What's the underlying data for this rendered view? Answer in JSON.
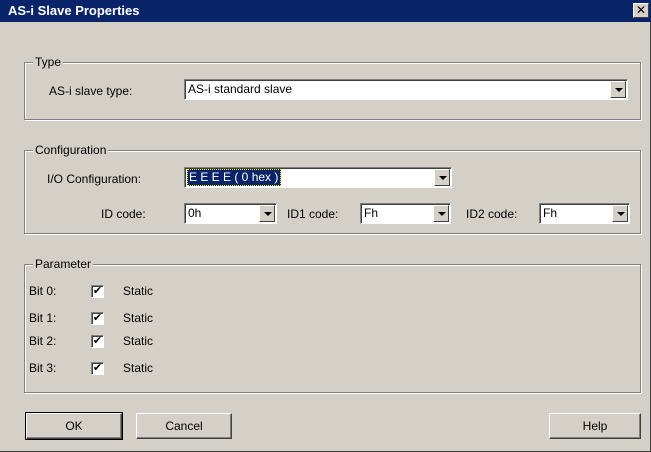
{
  "window": {
    "title": "AS-i Slave Properties",
    "close_glyph": "✕"
  },
  "type_group": {
    "legend": "Type",
    "slave_type_label": "AS-i slave type:",
    "slave_type_value": "AS-i standard slave"
  },
  "config_group": {
    "legend": "Configuration",
    "io_label": "I/O Configuration:",
    "io_value": "E  E  E  E ( 0 hex )",
    "id_label": "ID code:",
    "id_value": "0h",
    "id1_label": "ID1 code:",
    "id1_value": "Fh",
    "id2_label": "ID2 code:",
    "id2_value": "Fh"
  },
  "parameter_group": {
    "legend": "Parameter",
    "bits": [
      {
        "label": "Bit 0:",
        "checked": true,
        "status": "Static"
      },
      {
        "label": "Bit 1:",
        "checked": true,
        "status": "Static"
      },
      {
        "label": "Bit 2:",
        "checked": true,
        "status": "Static"
      },
      {
        "label": "Bit 3:",
        "checked": true,
        "status": "Static"
      }
    ]
  },
  "buttons": {
    "ok": "OK",
    "cancel": "Cancel",
    "help": "Help"
  },
  "check_glyph": "✔"
}
